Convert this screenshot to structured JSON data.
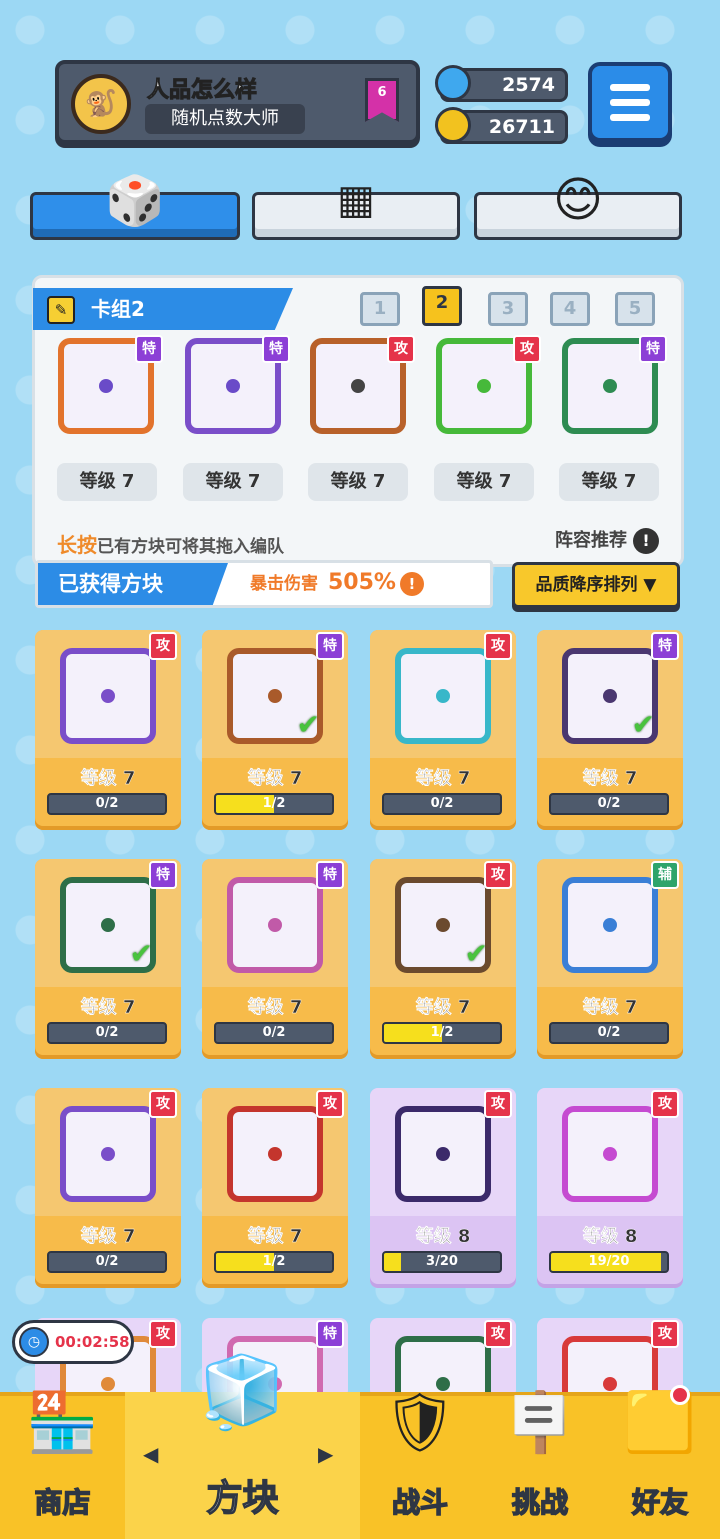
{
  "profile": {
    "name": "人品怎么样",
    "title": "随机点数大师",
    "rank": "6"
  },
  "currency": {
    "gems": "2574",
    "coins": "26711"
  },
  "deck": {
    "title": "卡组2",
    "numbers": [
      "1",
      "2",
      "3",
      "4",
      "5"
    ],
    "active": "2",
    "slots": [
      {
        "tag": "特",
        "level": "等级 7"
      },
      {
        "tag": "特",
        "level": "等级 7"
      },
      {
        "tag": "攻",
        "level": "等级 7"
      },
      {
        "tag": "攻",
        "level": "等级 7"
      },
      {
        "tag": "特",
        "level": "等级 7"
      }
    ],
    "hint_key": "长按",
    "hint_rest": "已有方块可将其拖入编队",
    "recommend": "阵容推荐",
    "recommend_icon": "!"
  },
  "obtained": {
    "title": "已获得方块",
    "crit_label": "暴击伤害",
    "crit_value": "505%",
    "crit_icon": "!"
  },
  "sort": {
    "label": "品质降序排列 ▼"
  },
  "cards": [
    {
      "tag": "攻",
      "level": "等级 7",
      "progress": "0/2",
      "fill": 0
    },
    {
      "tag": "特",
      "level": "等级 7",
      "progress": "1/2",
      "fill": 0.5
    },
    {
      "tag": "攻",
      "level": "等级 7",
      "progress": "0/2",
      "fill": 0
    },
    {
      "tag": "特",
      "level": "等级 7",
      "progress": "0/2",
      "fill": 0
    },
    {
      "tag": "特",
      "level": "等级 7",
      "progress": "0/2",
      "fill": 0
    },
    {
      "tag": "特",
      "level": "等级 7",
      "progress": "0/2",
      "fill": 0
    },
    {
      "tag": "攻",
      "level": "等级 7",
      "progress": "1/2",
      "fill": 0.5
    },
    {
      "tag": "辅",
      "level": "等级 7",
      "progress": "0/2",
      "fill": 0
    },
    {
      "tag": "攻",
      "level": "等级 7",
      "progress": "0/2",
      "fill": 0
    },
    {
      "tag": "攻",
      "level": "等级 7",
      "progress": "1/2",
      "fill": 0.5
    },
    {
      "tag": "攻",
      "level": "等级 8",
      "progress": "3/20",
      "fill": 0.15
    },
    {
      "tag": "攻",
      "level": "等级 8",
      "progress": "19/20",
      "fill": 0.95
    },
    {
      "tag": "攻"
    },
    {
      "tag": "特"
    },
    {
      "tag": "攻"
    },
    {
      "tag": "攻"
    }
  ],
  "timer": "00:02:58",
  "nav": {
    "shop": "商店",
    "blocks": "方块",
    "battle": "战斗",
    "challenge": "挑战",
    "friends": "好友",
    "left_arrow": "◀",
    "right_arrow": "▶"
  },
  "icons": {
    "menu": "menu-icon",
    "gem": "gem-icon",
    "coin": "coin-icon",
    "check": "✔"
  }
}
